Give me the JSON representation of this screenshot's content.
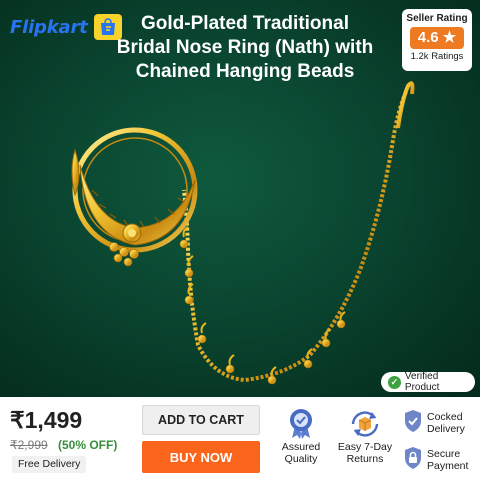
{
  "header": {
    "brand": "Flipkart",
    "brand_icon": "shopping-bag-icon",
    "title_line1": "Gold-Plated Traditional",
    "title_line2": "Bridal Nose Ring (Nath) with",
    "title_line3": "Chained Hanging Beads"
  },
  "rating_badge": {
    "label": "Seller Rating",
    "value": "4.6",
    "star": "★",
    "count": "1.2k Ratings"
  },
  "verified": {
    "label": "Verified Product",
    "icon": "check-circle-icon"
  },
  "pricing": {
    "price": "₹1,499",
    "mrp": "₹2,999",
    "discount": "(50% OFF)",
    "delivery": "Free Delivery"
  },
  "actions": {
    "add_to_cart": "ADD TO CART",
    "buy_now": "BUY NOW"
  },
  "features": {
    "assured_line1": "Assured",
    "assured_line2": "Quality",
    "returns_line1": "Easy 7-Day",
    "returns_line2": "Returns",
    "cod_line1": "Cocked",
    "cod_line2": "Delivery",
    "payment_line1": "Secure",
    "payment_line2": "Payment"
  },
  "colors": {
    "brand_blue": "#2874f0",
    "buy_orange": "#fb641b",
    "rating_orange": "#ee7a22",
    "background_green": "#0a4530",
    "gold": "#e8b51f"
  }
}
